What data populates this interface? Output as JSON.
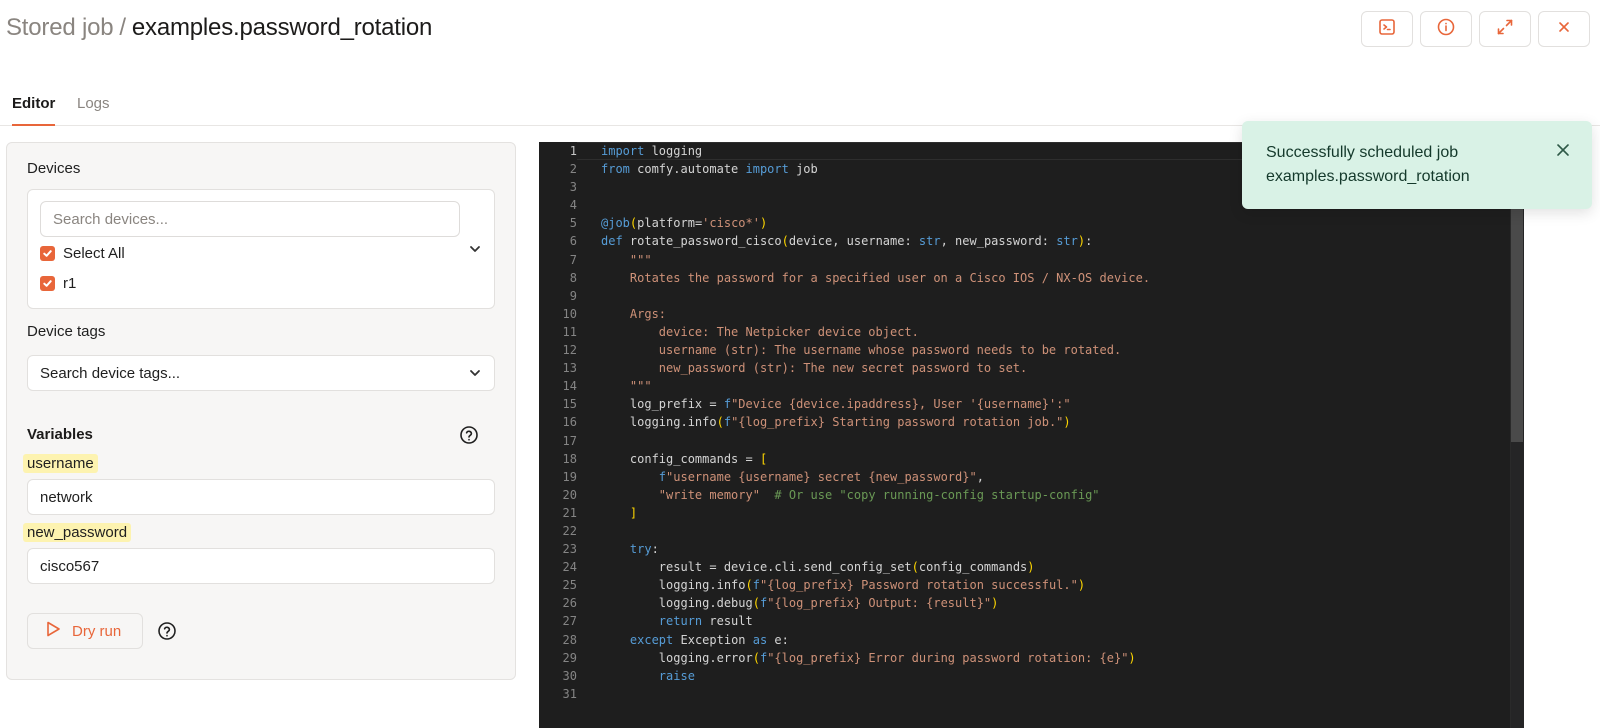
{
  "header": {
    "breadcrumb_parent": "Stored job",
    "separator": "/",
    "title": "examples.password_rotation",
    "actions": [
      {
        "icon": "terminal-icon"
      },
      {
        "icon": "info-icon"
      },
      {
        "icon": "expand-icon"
      },
      {
        "icon": "close-icon"
      }
    ]
  },
  "tabs": {
    "editor": "Editor",
    "logs": "Logs",
    "active": "Editor"
  },
  "form": {
    "devices_label": "Devices",
    "devices_search_placeholder": "Search devices...",
    "select_all_label": "Select All",
    "device_r1_label": "r1",
    "device_tags_label": "Device tags",
    "device_tags_placeholder": "Search device tags...",
    "variables_title": "Variables",
    "username_label": "username",
    "username_value": "network",
    "new_password_label": "new_password",
    "new_password_value": "cisco567",
    "dry_run_label": "Dry run"
  },
  "editor": {
    "line_numbers": [
      "1",
      "2",
      "3",
      "4",
      "5",
      "6",
      "7",
      "8",
      "9",
      "10",
      "11",
      "12",
      "13",
      "14",
      "15",
      "16",
      "17",
      "18",
      "19",
      "20",
      "21",
      "22",
      "23",
      "24",
      "25",
      "26",
      "27",
      "28",
      "29",
      "30",
      "31"
    ],
    "lines": [
      "import logging",
      "from comfy.automate import job",
      "",
      "",
      "@job(platform='cisco*')",
      "def rotate_password_cisco(device, username: str, new_password: str):",
      "    \"\"\"",
      "    Rotates the password for a specified user on a Cisco IOS / NX-OS device.",
      "",
      "    Args:",
      "        device: The Netpicker device object.",
      "        username (str): The username whose password needs to be rotated.",
      "        new_password (str): The new secret password to set.",
      "    \"\"\"",
      "    log_prefix = f\"Device {device.ipaddress}, User '{username}':\"",
      "    logging.info(f\"{log_prefix} Starting password rotation job.\")",
      "",
      "    config_commands = [",
      "        f\"username {username} secret {new_password}\",",
      "        \"write memory\"  # Or use \"copy running-config startup-config\"",
      "    ]",
      "",
      "    try:",
      "        result = device.cli.send_config_set(config_commands)",
      "        logging.info(f\"{log_prefix} Password rotation successful.\")",
      "        logging.debug(f\"{log_prefix} Output: {result}\")",
      "        return result",
      "    except Exception as e:",
      "        logging.error(f\"{log_prefix} Error during password rotation: {e}\")",
      "        raise",
      ""
    ]
  },
  "toast": {
    "message": "Successfully scheduled job examples.password_rotation"
  },
  "colors": {
    "accent": "#e8663a",
    "toast_bg": "#d9f2e6",
    "highlight": "#fdf3b0",
    "editor_bg": "#1e1e1e"
  }
}
